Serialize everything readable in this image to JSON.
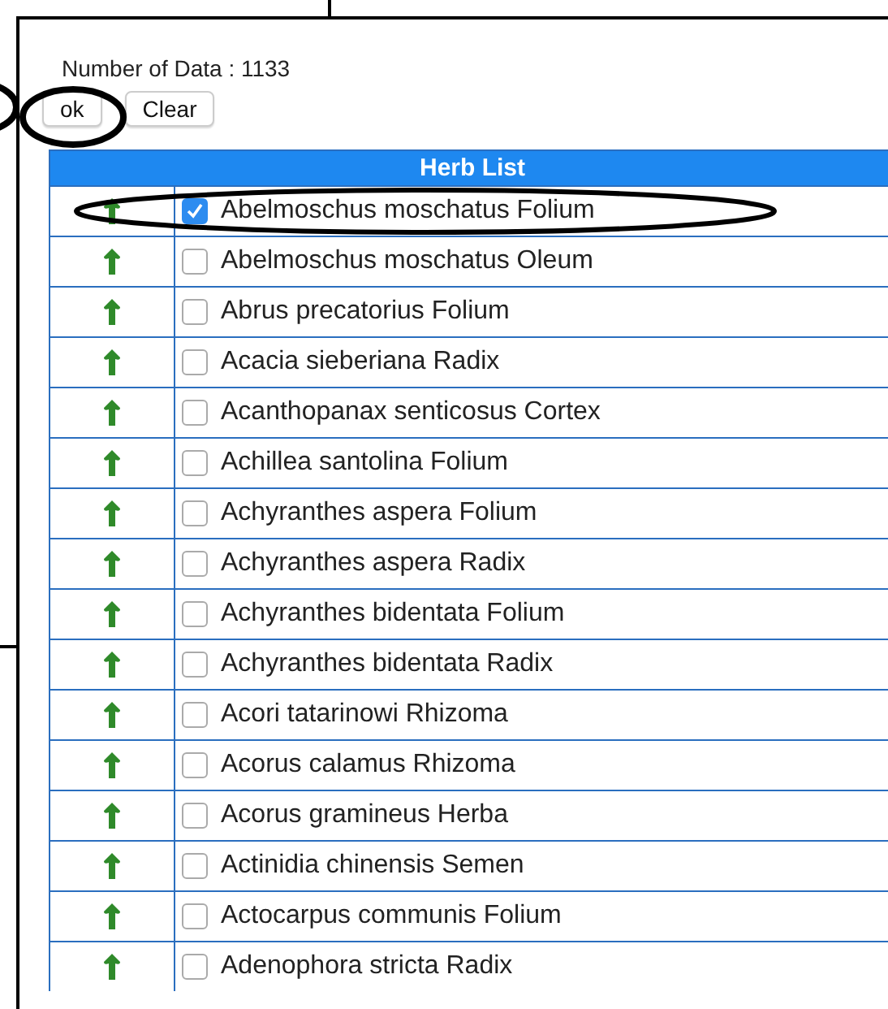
{
  "summary": {
    "label": "Number of Data : 1133"
  },
  "buttons": [
    {
      "label": "ok"
    },
    {
      "label": "Clear"
    }
  ],
  "table": {
    "title": "Herb List",
    "rows": [
      {
        "name": "Abelmoschus moschatus Folium",
        "checked": true
      },
      {
        "name": "Abelmoschus moschatus Oleum",
        "checked": false
      },
      {
        "name": "Abrus precatorius Folium",
        "checked": false
      },
      {
        "name": "Acacia sieberiana Radix",
        "checked": false
      },
      {
        "name": "Acanthopanax senticosus Cortex",
        "checked": false
      },
      {
        "name": "Achillea santolina Folium",
        "checked": false
      },
      {
        "name": "Achyranthes aspera Folium",
        "checked": false
      },
      {
        "name": "Achyranthes aspera Radix",
        "checked": false
      },
      {
        "name": "Achyranthes bidentata Folium",
        "checked": false
      },
      {
        "name": "Achyranthes bidentata Radix",
        "checked": false
      },
      {
        "name": "Acori tatarinowi Rhizoma",
        "checked": false
      },
      {
        "name": "Acorus calamus Rhizoma",
        "checked": false
      },
      {
        "name": "Acorus gramineus Herba",
        "checked": false
      },
      {
        "name": "Actinidia chinensis Semen",
        "checked": false
      },
      {
        "name": "Actocarpus communis Folium",
        "checked": false
      },
      {
        "name": "Adenophora stricta Radix",
        "checked": false
      }
    ]
  }
}
